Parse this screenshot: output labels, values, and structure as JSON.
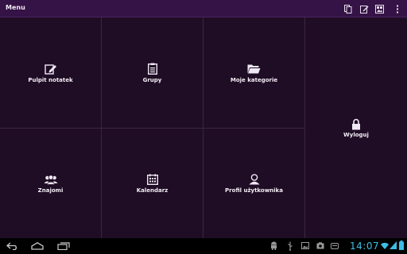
{
  "actionbar": {
    "title": "Menu",
    "icons": [
      "copy-icon",
      "edit-note-icon",
      "gallery-icon",
      "overflow-menu-icon"
    ]
  },
  "tiles": [
    {
      "label": "Pulpit notatek",
      "icon": "note-edit-icon"
    },
    {
      "label": "Grupy",
      "icon": "clipboard-icon"
    },
    {
      "label": "Moje kategorie",
      "icon": "folder-icon"
    },
    {
      "label": "Wyloguj",
      "icon": "lock-icon"
    },
    {
      "label": "Znajomi",
      "icon": "friends-icon"
    },
    {
      "label": "Kalendarz",
      "icon": "calendar-icon"
    },
    {
      "label": "Profil użytkownika",
      "icon": "user-icon"
    }
  ],
  "statusbar": {
    "time": "14:07",
    "icons": [
      "back-icon",
      "home-icon",
      "recent-apps-icon",
      "android-icon",
      "usb-icon",
      "image-icon",
      "screenshot-icon",
      "storage-icon",
      "wifi-icon",
      "signal-icon",
      "battery-icon"
    ]
  },
  "colors": {
    "actionbar": "#351346",
    "background": "#1f0d25",
    "divider": "#3a2442",
    "clock": "#3dbde6"
  }
}
